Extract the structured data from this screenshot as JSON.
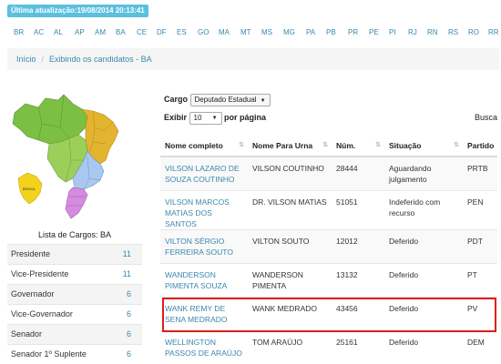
{
  "header": {
    "last_update": "Última atualização:19/08/2014 20:13:41"
  },
  "states": [
    "BR",
    "AC",
    "AL",
    "AP",
    "AM",
    "BA",
    "CE",
    "DF",
    "ES",
    "GO",
    "MA",
    "MT",
    "MS",
    "MG",
    "PA",
    "PB",
    "PR",
    "PE",
    "PI",
    "RJ",
    "RN",
    "RS",
    "RO",
    "RR"
  ],
  "breadcrumb": {
    "home": "Início",
    "current": "Exibindo os candidatos - BA"
  },
  "map": {
    "label": "BRASIL",
    "colors": {
      "north": "#7bc043",
      "northeast": "#e3b430",
      "center_west": "#9ccf5a",
      "southeast": "#a9c8ef",
      "south": "#d58be0",
      "inset": "#f2d21b"
    }
  },
  "cargo_list": {
    "title": "Lista de Cargos: BA",
    "items": [
      {
        "name": "Presidente",
        "count": "11"
      },
      {
        "name": "Vice-Presidente",
        "count": "11"
      },
      {
        "name": "Governador",
        "count": "6"
      },
      {
        "name": "Vice-Governador",
        "count": "6"
      },
      {
        "name": "Senador",
        "count": "6"
      },
      {
        "name": "Senador 1º Suplente",
        "count": "6"
      }
    ]
  },
  "filters": {
    "cargo_label": "Cargo",
    "cargo_value": "Deputado Estadual",
    "show_label": "Exibir",
    "show_value": "10",
    "per_page_label": "por página",
    "search_label": "Busca"
  },
  "table": {
    "headers": [
      "Nome completo",
      "Nome Para Urna",
      "Núm.",
      "Situação",
      "Partido"
    ],
    "rows": [
      {
        "name": "VILSON LAZARO DE SOUZA COUTINHO",
        "urn": "VILSON COUTINHO",
        "num": "28444",
        "status": "Aguardando julgamento",
        "party": "PRTB"
      },
      {
        "name": "VILSON MARCOS MATIAS DOS SANTOS",
        "urn": "DR. VILSON MATIAS",
        "num": "51051",
        "status": "Indeferido com recurso",
        "party": "PEN"
      },
      {
        "name": "VILTON SÉRGIO FERREIRA SOUTO",
        "urn": "VILTON SOUTO",
        "num": "12012",
        "status": "Deferido",
        "party": "PDT"
      },
      {
        "name": "WANDERSON PIMENTA SOUZA",
        "urn": "WANDERSON PIMENTA",
        "num": "13132",
        "status": "Deferido",
        "party": "PT"
      },
      {
        "name": "WANK REMY DE SENA MEDRADO",
        "urn": "WANK MEDRADO",
        "num": "43456",
        "status": "Deferido",
        "party": "PV"
      },
      {
        "name": "WELLINGTON PASSOS DE ARAÚJO",
        "urn": "TOM ARAÚJO",
        "num": "25161",
        "status": "Deferido",
        "party": "DEM"
      }
    ]
  }
}
